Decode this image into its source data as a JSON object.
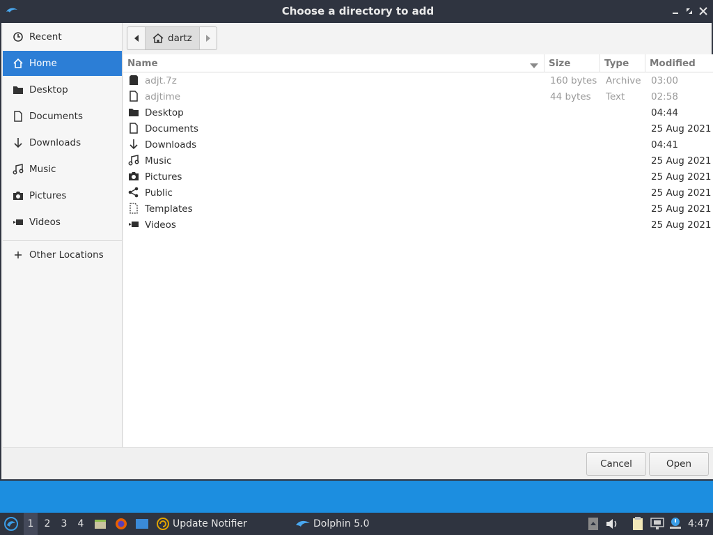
{
  "window": {
    "title": "Choose a directory to add"
  },
  "sidebar": {
    "items": [
      {
        "label": "Recent",
        "icon": "clock-icon"
      },
      {
        "label": "Home",
        "icon": "home-icon"
      },
      {
        "label": "Desktop",
        "icon": "folder-icon"
      },
      {
        "label": "Documents",
        "icon": "document-icon"
      },
      {
        "label": "Downloads",
        "icon": "download-arrow-icon"
      },
      {
        "label": "Music",
        "icon": "music-note-icon"
      },
      {
        "label": "Pictures",
        "icon": "camera-icon"
      },
      {
        "label": "Videos",
        "icon": "video-icon"
      }
    ],
    "other_locations": "Other Locations"
  },
  "pathbar": {
    "crumb": "dartz"
  },
  "columns": {
    "name": "Name",
    "size": "Size",
    "type": "Type",
    "modified": "Modified"
  },
  "files": [
    {
      "name": "adjt.7z",
      "size": "160 bytes",
      "type": "Archive",
      "modified": "03:00",
      "icon": "archive-file-icon"
    },
    {
      "name": "adjtime",
      "size": "44 bytes",
      "type": "Text",
      "modified": "02:58",
      "icon": "text-file-icon"
    },
    {
      "name": "Desktop",
      "size": "",
      "type": "",
      "modified": "04:44",
      "icon": "folder-icon"
    },
    {
      "name": "Documents",
      "size": "",
      "type": "",
      "modified": "25 Aug 2021",
      "icon": "document-icon"
    },
    {
      "name": "Downloads",
      "size": "",
      "type": "",
      "modified": "04:41",
      "icon": "download-arrow-icon"
    },
    {
      "name": "Music",
      "size": "",
      "type": "",
      "modified": "25 Aug 2021",
      "icon": "music-note-icon"
    },
    {
      "name": "Pictures",
      "size": "",
      "type": "",
      "modified": "25 Aug 2021",
      "icon": "camera-icon"
    },
    {
      "name": "Public",
      "size": "",
      "type": "",
      "modified": "25 Aug 2021",
      "icon": "share-icon"
    },
    {
      "name": "Templates",
      "size": "",
      "type": "",
      "modified": "25 Aug 2021",
      "icon": "template-icon"
    },
    {
      "name": "Videos",
      "size": "",
      "type": "",
      "modified": "25 Aug 2021",
      "icon": "video-icon"
    }
  ],
  "buttons": {
    "cancel": "Cancel",
    "open": "Open"
  },
  "taskbar": {
    "workspaces": [
      "1",
      "2",
      "3",
      "4"
    ],
    "update_notifier": "Update Notifier",
    "dolphin": "Dolphin 5.0",
    "clock": "4:47"
  },
  "colors": {
    "accent": "#2c7ed6",
    "titlebar": "#2f3440",
    "desktop": "#1c8ee0"
  }
}
